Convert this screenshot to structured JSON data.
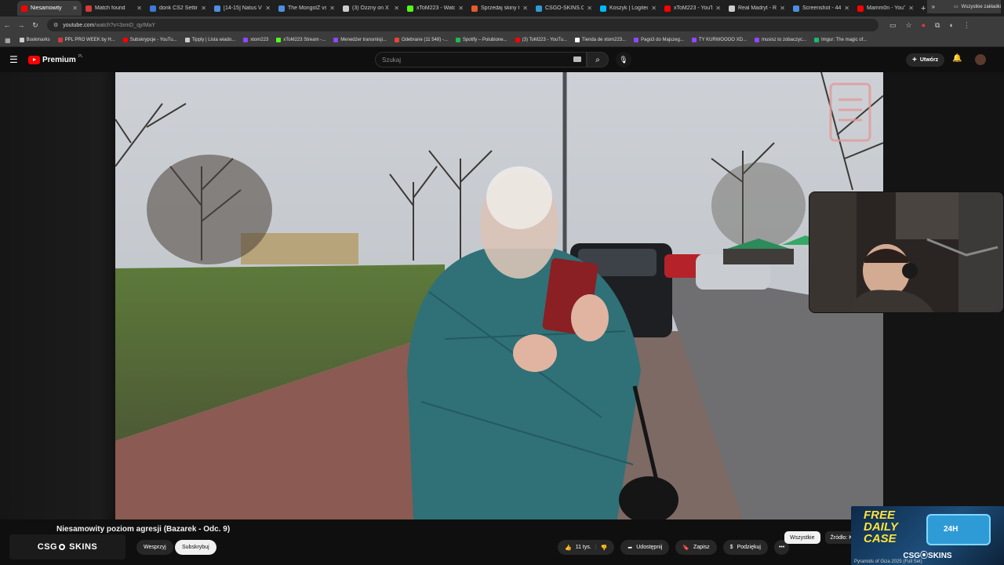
{
  "browser": {
    "tabs": [
      {
        "title": "Niesamowity",
        "color": "#ff0000",
        "active": true
      },
      {
        "title": "Match found",
        "color": "#d23b3b"
      },
      {
        "title": "donk CS2 Settings",
        "color": "#3a7bd5"
      },
      {
        "title": "[14-15] Natus Vi",
        "color": "#4a90e2"
      },
      {
        "title": "The MongolZ vs.",
        "color": "#4a90e2"
      },
      {
        "title": "(3) Ozzny on X",
        "color": "#cccccc"
      },
      {
        "title": "xToM223 - Watch",
        "color": "#53fc18"
      },
      {
        "title": "Sprzedaj skiny CS",
        "color": "#e55b2d"
      },
      {
        "title": "CSGO-SKINS.COM",
        "color": "#2f9bd6"
      },
      {
        "title": "Koszyk | Logitech",
        "color": "#00b8fc"
      },
      {
        "title": "xToM223 - YouTube",
        "color": "#ff0000"
      },
      {
        "title": "Real Madryt - Rayo",
        "color": "#cccccc"
      },
      {
        "title": "Screenshot - 447",
        "color": "#4a90e2"
      },
      {
        "title": "Mamm0n - YouTube",
        "color": "#ff0000"
      }
    ],
    "new_tab": "+",
    "window_controls": [
      "–",
      "◻",
      "✕"
    ],
    "url_host": "youtube.com",
    "url_path": "/watch?v=3xmD_qyIMaY",
    "bookmarks": [
      {
        "label": "Bookmarks",
        "color": "#cccccc"
      },
      {
        "label": "PPL PRO WEEK by H...",
        "color": "#d23b3b"
      },
      {
        "label": "Subskrypcje - YouTu...",
        "color": "#ff0000"
      },
      {
        "label": "Tipply | Lista wiado...",
        "color": "#cccccc"
      },
      {
        "label": "xtom223",
        "color": "#9146ff"
      },
      {
        "label": "xToM223 Stream -...",
        "color": "#53fc18"
      },
      {
        "label": "Menedżer transmisji...",
        "color": "#9146ff"
      },
      {
        "label": "Odebrane (11 548) -...",
        "color": "#ea4335"
      },
      {
        "label": "Spotify – Polubione...",
        "color": "#1db954"
      },
      {
        "label": "(3) ToM223 - YouTu...",
        "color": "#ff0000"
      },
      {
        "label": "Tienda de xtom223...",
        "color": "#ffffff"
      },
      {
        "label": "Pago3 do Majszeg...",
        "color": "#9146ff"
      },
      {
        "label": "TY KURWOOOO XD...",
        "color": "#9146ff"
      },
      {
        "label": "musisz to zobaczyc...",
        "color": "#9146ff"
      },
      {
        "label": "Imgur: The magic of...",
        "color": "#1bb76e"
      }
    ],
    "bookmarks_overflow": "»",
    "all_bookmarks": "Wszystkie zakładki"
  },
  "youtube": {
    "logo": "Premium",
    "logo_country": "PL",
    "search_placeholder": "Szukaj",
    "create_label": "Utwórz",
    "video_title": "Niesamowity poziom agresji (Bazarek - Odc. 9)",
    "channel_name_a": "CSG",
    "channel_name_b": "SKINS",
    "join_label": "Wesprzyj",
    "subscribe_label": "Subskrybuj",
    "likes": "11 tys.",
    "share_label": "Udostępnij",
    "save_label": "Zapisz",
    "thanks_label": "Podziękuj",
    "more_label": "•••",
    "chips": [
      "Wszystkie",
      "Źródło: Ko"
    ]
  },
  "ad": {
    "line1": "FREE",
    "line2": "DAILY",
    "line3": "CASE",
    "badge": "24H",
    "brand": "CSG⦿SKINS",
    "caption": "Pyramids of Giza 2025 (Full Set)"
  }
}
